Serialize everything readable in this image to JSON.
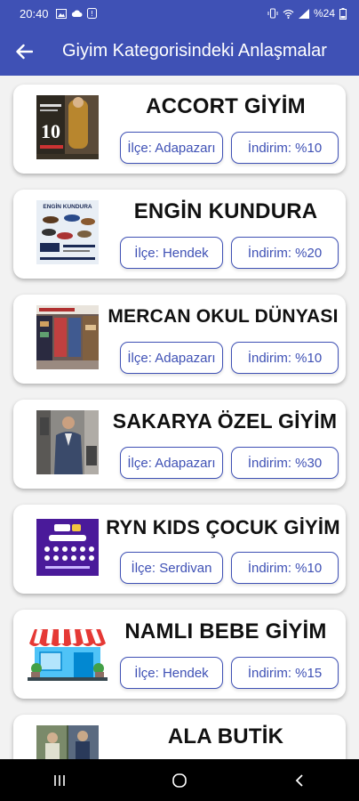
{
  "status_bar": {
    "time": "20:40",
    "battery": "%24",
    "icons": [
      "image-icon",
      "cloud-icon",
      "notification-icon",
      "vibrate-icon",
      "wifi-icon",
      "signal-icon",
      "battery-icon"
    ]
  },
  "app_bar": {
    "title": "Giyim Kategorisindeki Anlaşmalar",
    "back_icon": "arrow-back-icon"
  },
  "deals": [
    {
      "name": "ACCORT GİYİM",
      "district": "İlçe: Adapazarı",
      "discount": "İndirim: %10",
      "thumb": "fashion-poster"
    },
    {
      "name": "ENGİN KUNDURA",
      "district": "İlçe: Hendek",
      "discount": "İndirim: %20",
      "thumb": "shoes-ad"
    },
    {
      "name": "MERCAN OKUL DÜNYASI",
      "district": "İlçe: Adapazarı",
      "discount": "İndirim: %10",
      "thumb": "school-shop"
    },
    {
      "name": "SAKARYA ÖZEL GİYİM",
      "district": "İlçe: Adapazarı",
      "discount": "İndirim: %30",
      "thumb": "suit-man"
    },
    {
      "name": "RYN KIDS ÇOCUK GİYİM",
      "district": "İlçe: Serdivan",
      "discount": "İndirim: %10",
      "thumb": "purple-flyer"
    },
    {
      "name": "NAMLI BEBE GİYİM",
      "district": "İlçe: Hendek",
      "discount": "İndirim: %15",
      "thumb": "storefront-icon"
    },
    {
      "name": "ALA BUTİK",
      "district": "",
      "discount": "",
      "thumb": "boutique-photo"
    }
  ],
  "thumb_texts": {
    "accort_badge": "10",
    "engin_brand": "ENGİN KUNDURA"
  },
  "nav_bar": {
    "buttons": [
      "recent-apps-icon",
      "home-icon",
      "back-icon"
    ]
  },
  "colors": {
    "primary": "#3f51b5",
    "card_bg": "#ffffff",
    "page_bg": "#f2f2f2"
  }
}
